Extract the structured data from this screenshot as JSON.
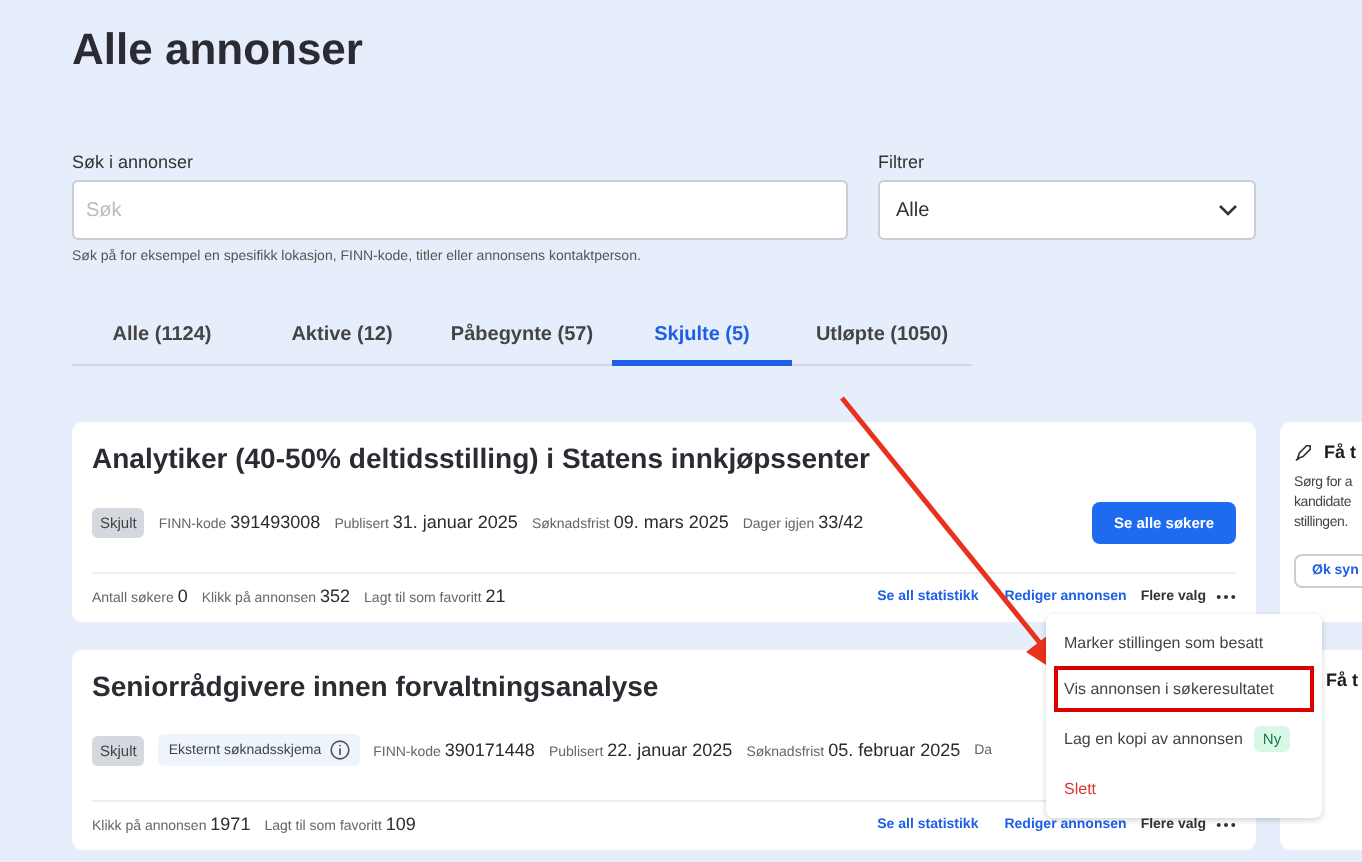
{
  "title": "Alle annonser",
  "search": {
    "label": "Søk i annonser",
    "placeholder": "Søk",
    "help": "Søk på for eksempel en spesifikk lokasjon, FINN-kode, titler eller annonsens kontaktperson."
  },
  "filter": {
    "label": "Filtrer",
    "value": "Alle"
  },
  "tabs": [
    {
      "label": "Alle (1124)",
      "selected": false
    },
    {
      "label": "Aktive (12)",
      "selected": false
    },
    {
      "label": "Påbegynte (57)",
      "selected": false
    },
    {
      "label": "Skjulte (5)",
      "selected": true
    },
    {
      "label": "Utløpte (1050)",
      "selected": false
    }
  ],
  "ads": [
    {
      "title": "Analytiker (40-50% deltidsstilling) i Statens innkjøpssenter",
      "status": "Skjult",
      "meta": [
        {
          "label": "FINN-kode",
          "value": "391493008"
        },
        {
          "label": "Publisert",
          "value": "31. januar 2025"
        },
        {
          "label": "Søknadsfrist",
          "value": "09. mars 2025"
        },
        {
          "label": "Dager igjen",
          "value": "33/42"
        }
      ],
      "button": "Se alle søkere",
      "stats": [
        {
          "label": "Antall søkere",
          "value": "0"
        },
        {
          "label": "Klikk på annonsen",
          "value": "352"
        },
        {
          "label": "Lagt til som favoritt",
          "value": "21"
        }
      ],
      "links": [
        "Se all statistikk",
        "Rediger annonsen"
      ],
      "more": "Flere valg"
    },
    {
      "title": "Seniorrådgivere innen forvaltningsanalyse",
      "status": "Skjult",
      "external": "Eksternt søknadsskjema",
      "meta": [
        {
          "label": "FINN-kode",
          "value": "390171448"
        },
        {
          "label": "Publisert",
          "value": "22. januar 2025"
        },
        {
          "label": "Søknadsfrist",
          "value": "05. februar 2025"
        },
        {
          "label": "Da"
        }
      ],
      "stats": [
        {
          "label": "Klikk på annonsen",
          "value": "1971"
        },
        {
          "label": "Lagt til som favoritt",
          "value": "109"
        }
      ],
      "links": [
        "Se all statistikk",
        "Rediger annonsen"
      ],
      "more": "Flere valg"
    }
  ],
  "side_cards": [
    {
      "title": "Få t",
      "icon": true,
      "lines": [
        "Sørg for a",
        "kandidate",
        "stillingen."
      ],
      "button": "Øk syn"
    },
    {
      "title": "Få t",
      "icon": false
    }
  ],
  "menu": {
    "items": [
      {
        "label": "Marker stillingen som besatt",
        "kind": "normal",
        "highlighted": false
      },
      {
        "label": "Vis annonsen i søkeresultatet",
        "kind": "normal",
        "highlighted": true
      },
      {
        "label": "Lag en kopi av annonsen",
        "kind": "normal",
        "highlighted": false,
        "badge": "Ny"
      },
      {
        "label": "Slett",
        "kind": "danger",
        "highlighted": false
      }
    ]
  }
}
